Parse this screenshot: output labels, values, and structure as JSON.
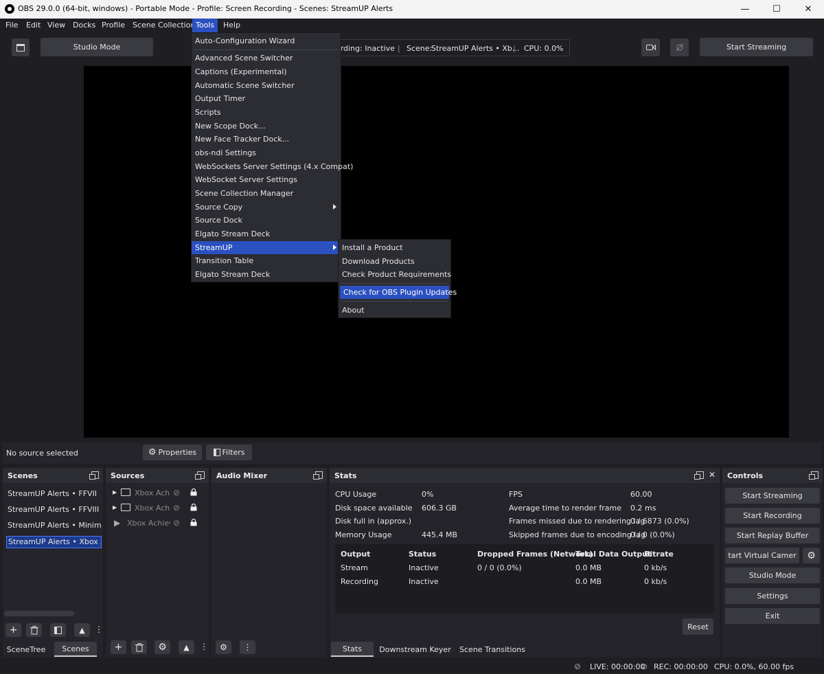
{
  "window": {
    "title": "OBS 29.0.0 (64-bit, windows) - Portable Mode - Profile: Screen Recording - Scenes: StreamUP Alerts",
    "minimize": "—",
    "maximize": "☐",
    "close": "✕"
  },
  "menubar": [
    "File",
    "Edit",
    "View",
    "Docks",
    "Profile",
    "Scene Collection",
    "Tools",
    "Help"
  ],
  "toolbar": {
    "studio_mode": "Studio Mode",
    "start_streaming": "Start Streaming",
    "status": {
      "recording": "ording: Inactive",
      "sep1": "|",
      "scene_label": "Scene:",
      "scene_value": "StreamUP Alerts • Xb...",
      "sep2": "|",
      "cpu": "CPU: 0.0%"
    }
  },
  "tools_menu": [
    "Auto-Configuration Wizard",
    "Advanced Scene Switcher",
    "Captions (Experimental)",
    "Automatic Scene Switcher",
    "Output Timer",
    "Scripts",
    "New Scope Dock...",
    "New Face Tracker Dock...",
    "obs-ndi Settings",
    "WebSockets Server Settings (4.x Compat)",
    "WebSocket Server Settings",
    "Scene Collection Manager",
    "Source Copy",
    "Source Dock",
    "Elgato Stream Deck",
    "StreamUP",
    "Transition Table",
    "Elgato Stream Deck"
  ],
  "streamup_menu": [
    "Install a Product",
    "Download Products",
    "Check Product Requirements",
    "Check for OBS Plugin Updates",
    "About"
  ],
  "sourcebar": {
    "no_source": "No source selected",
    "properties": "Properties",
    "filters": "Filters"
  },
  "scenes": {
    "title": "Scenes",
    "items": [
      "StreamUP Alerts • FFVII",
      "StreamUP Alerts • FFVIII",
      "StreamUP Alerts • Minim",
      "StreamUP Alerts • Xbox Achi"
    ],
    "tabs": [
      "SceneTree",
      "Scenes"
    ]
  },
  "sources": {
    "title": "Sources",
    "items": [
      "Xbox Achie",
      "Xbox Achie",
      "Xbox Achieve"
    ]
  },
  "audio_mixer": {
    "title": "Audio Mixer"
  },
  "stats": {
    "title": "Stats",
    "left": [
      {
        "label": "CPU Usage",
        "value": "0%"
      },
      {
        "label": "Disk space available",
        "value": "606.3 GB"
      },
      {
        "label": "Disk full in (approx.)",
        "value": ""
      },
      {
        "label": "Memory Usage",
        "value": "445.4 MB"
      }
    ],
    "right": [
      {
        "label": "FPS",
        "value": "60.00"
      },
      {
        "label": "Average time to render frame",
        "value": "0.2 ms"
      },
      {
        "label": "Frames missed due to rendering lag",
        "value": "0 / 6873 (0.0%)"
      },
      {
        "label": "Skipped frames due to encoding lag",
        "value": "0 / 0 (0.0%)"
      }
    ],
    "table": {
      "headers": [
        "Output",
        "Status",
        "Dropped Frames (Network)",
        "Total Data Output",
        "Bitrate"
      ],
      "rows": [
        [
          "Stream",
          "Inactive",
          "0 / 0 (0.0%)",
          "0.0 MB",
          "0 kb/s"
        ],
        [
          "Recording",
          "Inactive",
          "",
          "0.0 MB",
          "0 kb/s"
        ]
      ]
    },
    "reset": "Reset",
    "tabs": [
      "Stats",
      "Downstream Keyer",
      "Scene Transitions"
    ]
  },
  "controls": {
    "title": "Controls",
    "buttons": [
      "Start Streaming",
      "Start Recording",
      "Start Replay Buffer",
      "tart Virtual Camer",
      "Studio Mode",
      "Settings",
      "Exit"
    ]
  },
  "statusbar": {
    "live": "LIVE: 00:00:00",
    "rec": "REC: 00:00:00",
    "cpu": "CPU: 0.0%, 60.00 fps"
  }
}
